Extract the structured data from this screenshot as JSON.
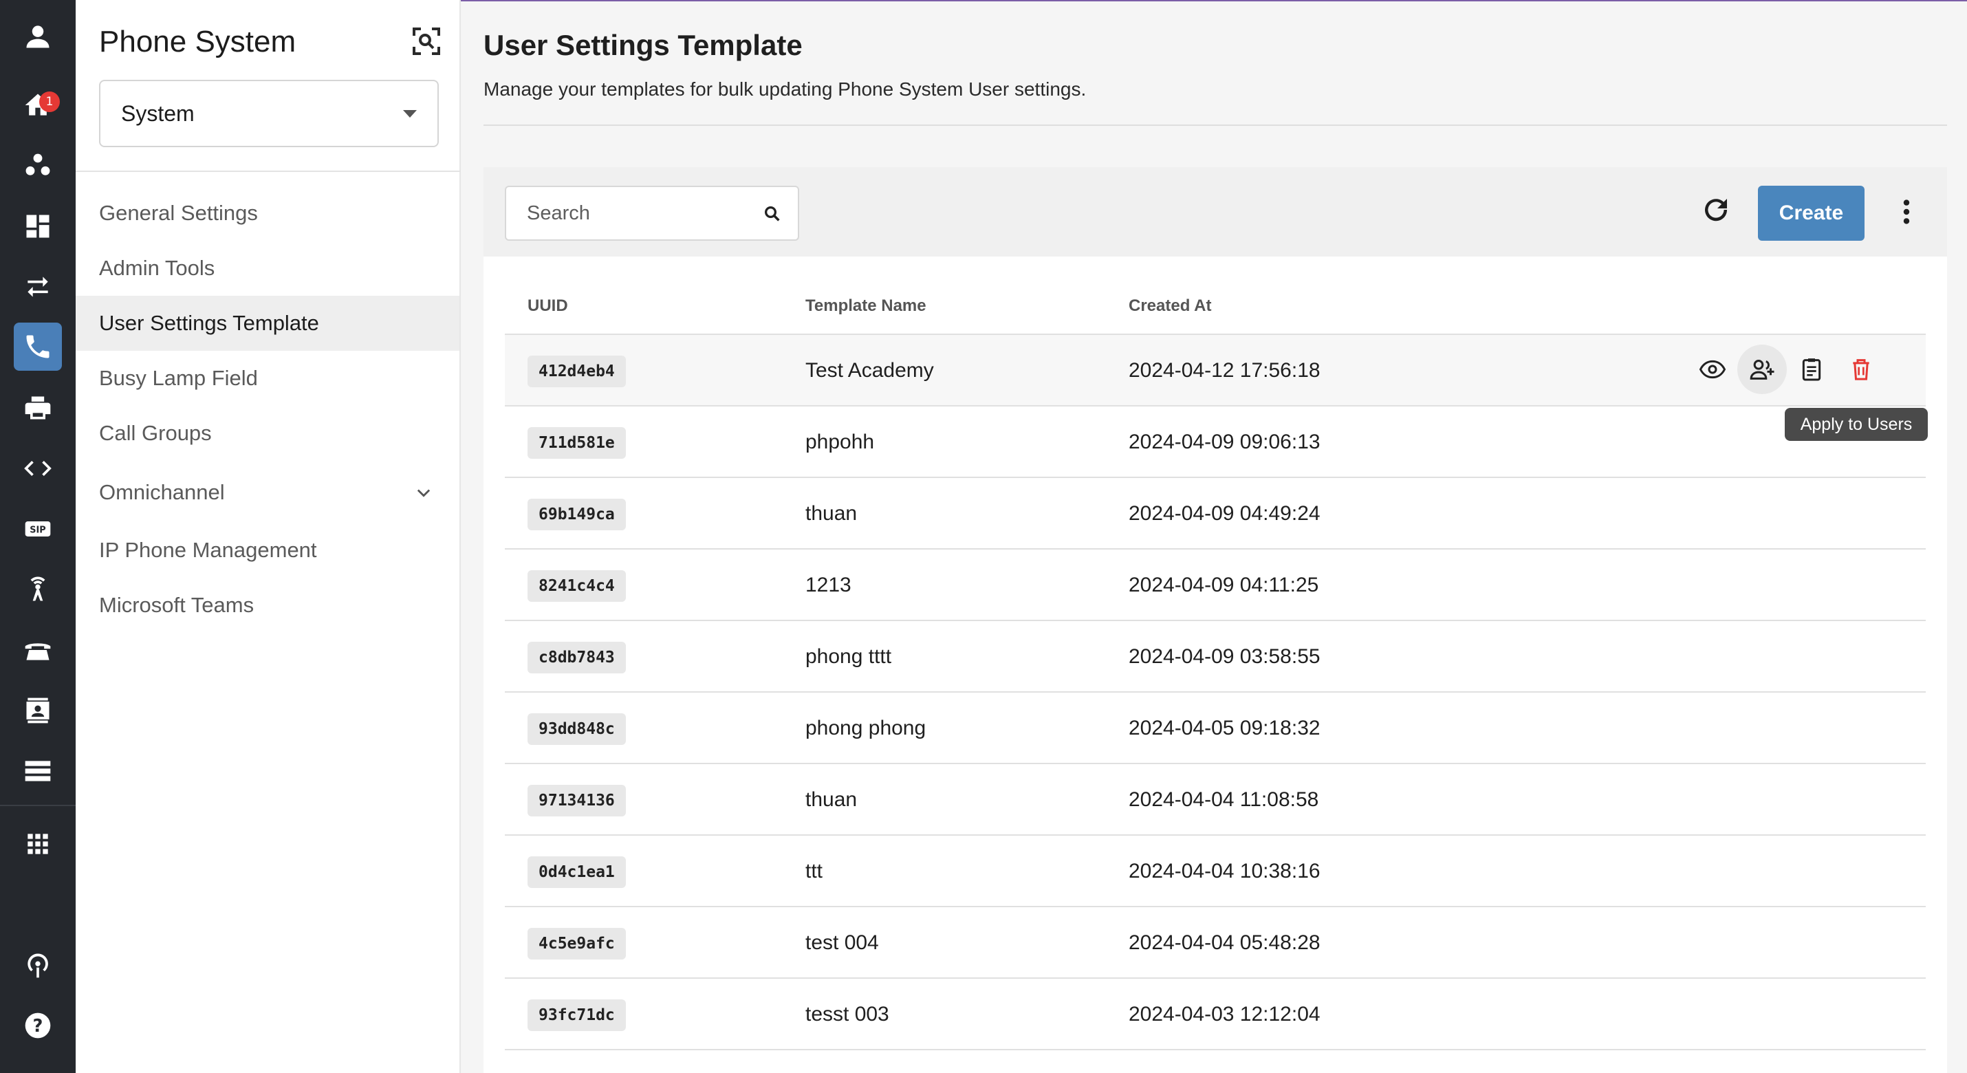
{
  "rail": {
    "notification_count": "1"
  },
  "sidebar": {
    "title": "Phone System",
    "selector_value": "System",
    "items": [
      {
        "label": "General Settings"
      },
      {
        "label": "Admin Tools"
      },
      {
        "label": "User Settings Template"
      },
      {
        "label": "Busy Lamp Field"
      },
      {
        "label": "Call Groups"
      },
      {
        "label": "Omnichannel"
      },
      {
        "label": "IP Phone Management"
      },
      {
        "label": "Microsoft Teams"
      }
    ]
  },
  "main": {
    "title": "User Settings Template",
    "subtitle": "Manage your templates for bulk updating Phone System User settings."
  },
  "toolbar": {
    "search_placeholder": "Search",
    "create_label": "Create"
  },
  "table": {
    "columns": [
      "UUID",
      "Template Name",
      "Created At"
    ],
    "rows": [
      {
        "uuid": "412d4eb4",
        "name": "Test Academy",
        "created": "2024-04-12 17:56:18"
      },
      {
        "uuid": "711d581e",
        "name": "phpohh",
        "created": "2024-04-09 09:06:13"
      },
      {
        "uuid": "69b149ca",
        "name": "thuan",
        "created": "2024-04-09 04:49:24"
      },
      {
        "uuid": "8241c4c4",
        "name": "1213",
        "created": "2024-04-09 04:11:25"
      },
      {
        "uuid": "c8db7843",
        "name": "phong tttt",
        "created": "2024-04-09 03:58:55"
      },
      {
        "uuid": "93dd848c",
        "name": "phong phong",
        "created": "2024-04-05 09:18:32"
      },
      {
        "uuid": "97134136",
        "name": "thuan",
        "created": "2024-04-04 11:08:58"
      },
      {
        "uuid": "0d4c1ea1",
        "name": "ttt",
        "created": "2024-04-04 10:38:16"
      },
      {
        "uuid": "4c5e9afc",
        "name": "test 004",
        "created": "2024-04-04 05:48:28"
      },
      {
        "uuid": "93fc71dc",
        "name": "tesst 003",
        "created": "2024-04-03 12:12:04"
      }
    ]
  },
  "tooltip": {
    "text": "Apply to Users"
  },
  "colors": {
    "rail_bg": "#25282d",
    "rail_active": "#4a7fb8",
    "primary_button": "#4a86bd",
    "delete_icon": "#e53935",
    "badge": "#e53935"
  },
  "icons": {
    "rail": [
      "user-icon",
      "home-icon",
      "group-icon",
      "dashboard-icon",
      "transfer-icon",
      "phone-icon",
      "printer-icon",
      "code-icon",
      "sip-icon",
      "antenna-icon",
      "desk-phone-icon",
      "contact-card-icon",
      "server-icon",
      "apps-grid-icon",
      "podcast-icon",
      "help-icon"
    ],
    "row_actions": [
      "view-icon",
      "apply-to-users-icon",
      "clipboard-icon",
      "delete-icon"
    ]
  }
}
